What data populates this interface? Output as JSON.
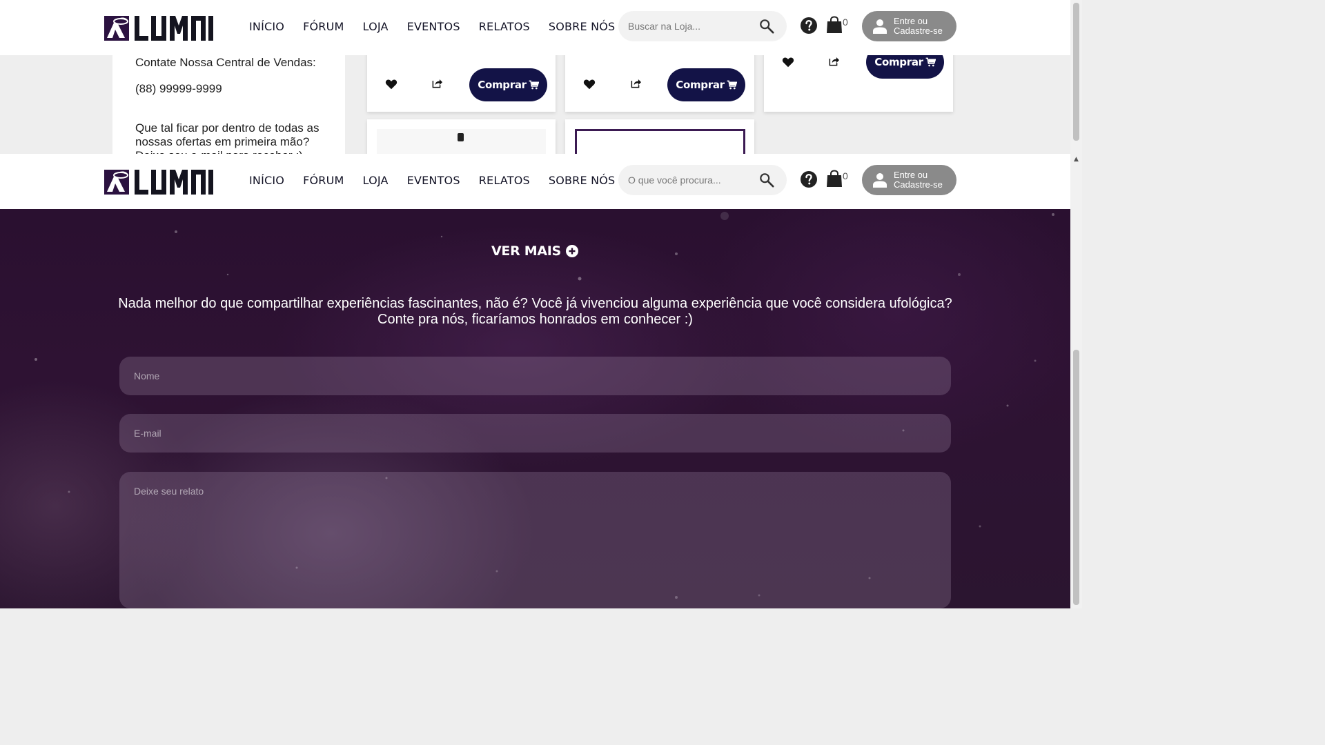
{
  "brand": {
    "name": "LUMNI"
  },
  "header_top": {
    "nav": [
      "INÍCIO",
      "FÓRUM",
      "LOJA",
      "EVENTOS",
      "RELATOS",
      "SOBRE NÓS"
    ],
    "search_placeholder": "Buscar na Loja...",
    "cart_count": "0",
    "login_label": "Entre ou\nCadastre-se"
  },
  "header_bottom": {
    "nav": [
      "INÍCIO",
      "FÓRUM",
      "LOJA",
      "EVENTOS",
      "RELATOS",
      "SOBRE NÓS"
    ],
    "search_placeholder": "O que você procura...",
    "cart_count": "0",
    "login_label": "Entre ou\nCadastre-se"
  },
  "sidebar": {
    "contact_label": "Contate Nossa Central de Vendas:",
    "phone": "(88) 99999-9999",
    "promo_text": "Que tal ficar por dentro de todas as nossas ofertas em primeira mão? Deixe seu e-mail para receber :)"
  },
  "products": {
    "buy_label": "Comprar"
  },
  "relatos": {
    "see_more": "VER MAIS",
    "invite_text": "Nada melhor do que compartilhar experiências fascinantes, não é? Você já vivenciou alguma experiência que você considera ufológica? Conte pra nós, ficaríamos honrados em conhecer :)",
    "name_placeholder": "Nome",
    "email_placeholder": "E-mail",
    "message_placeholder": "Deixe seu relato"
  },
  "colors": {
    "brand_navy": "#131347",
    "header_bg": "#ffffff",
    "login_bg": "#8a8a8a",
    "galaxy_bg": "#2b1230"
  },
  "icons": [
    "logo-ufo-icon",
    "search-icon",
    "help-icon",
    "shopping-bag-icon",
    "user-icon",
    "heart-icon",
    "share-icon",
    "cart-icon",
    "plus-circle-icon"
  ]
}
